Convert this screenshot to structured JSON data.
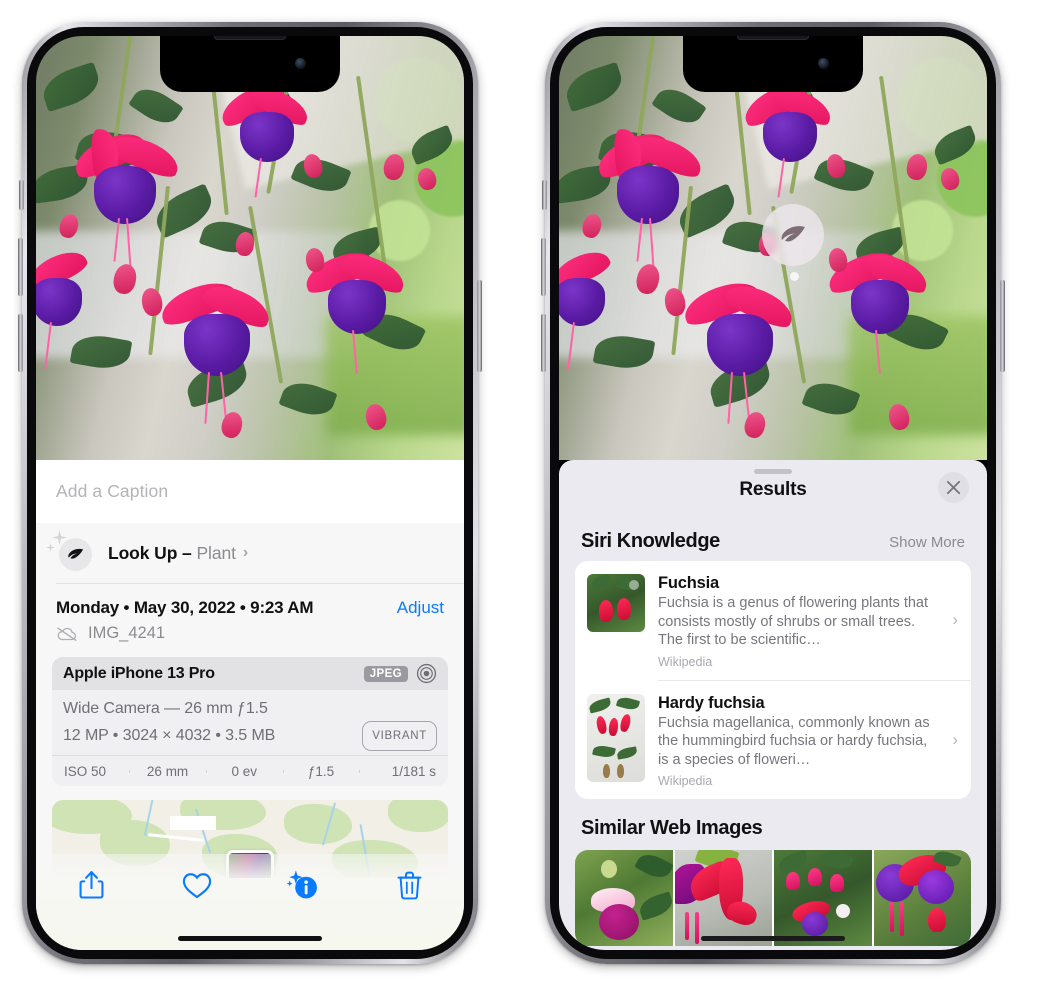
{
  "left_phone": {
    "photo_alt": "Fuchsia flowers hanging basket",
    "caption_placeholder": "Add a Caption",
    "lookup": {
      "label": "Look Up – ",
      "subject": "Plant",
      "chevron": "›",
      "icon": "leaf-icon"
    },
    "date": "Monday • May 30, 2022 • 9:23 AM",
    "adjust_label": "Adjust",
    "file_name": "IMG_4241",
    "cloud_icon": "cloud-slash-icon",
    "exif": {
      "device": "Apple iPhone 13 Pro",
      "format_badge": "JPEG",
      "raw_icon": "aperture-icon",
      "lens_line": "Wide Camera — 26 mm ƒ1.5",
      "specs_line": "12 MP • 3024 × 4032 • 3.5 MB",
      "style_badge": "VIBRANT",
      "stats": [
        "ISO 50",
        "26 mm",
        "0 ev",
        "ƒ1.5",
        "1/181 s"
      ]
    },
    "toolbar": [
      {
        "name": "share-button",
        "icon": "share-icon"
      },
      {
        "name": "favorite-button",
        "icon": "heart-icon"
      },
      {
        "name": "info-button",
        "icon": "info-sparkle-icon"
      },
      {
        "name": "delete-button",
        "icon": "trash-icon"
      }
    ],
    "accent_color": "#0a7bff"
  },
  "right_phone": {
    "badge_icon": "leaf-icon",
    "sheet": {
      "title": "Results",
      "close_icon": "close-icon",
      "siri_section": {
        "title": "Siri Knowledge",
        "show_more": "Show More",
        "items": [
          {
            "title": "Fuchsia",
            "description": "Fuchsia is a genus of flowering plants that consists mostly of shrubs or small trees. The first to be scientific…",
            "source": "Wikipedia",
            "chevron": "›"
          },
          {
            "title": "Hardy fuchsia",
            "description": "Fuchsia magellanica, commonly known as the hummingbird fuchsia or hardy fuchsia, is a species of floweri…",
            "source": "Wikipedia",
            "chevron": "›"
          }
        ]
      },
      "web_section": {
        "title": "Similar Web Images",
        "tiles": [
          "web-image-1",
          "web-image-2",
          "web-image-3",
          "web-image-4"
        ]
      }
    },
    "sheet_color": "#eceaf1"
  }
}
